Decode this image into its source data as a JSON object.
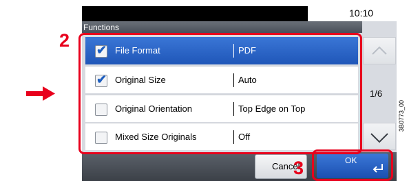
{
  "header": {
    "clock": "10:10",
    "section_title": "Functions"
  },
  "rows": [
    {
      "label": "File Format",
      "value": "PDF",
      "checked": true,
      "selected": true
    },
    {
      "label": "Original Size",
      "value": "Auto",
      "checked": true,
      "selected": false
    },
    {
      "label": "Original Orientation",
      "value": "Top Edge on Top",
      "checked": false,
      "selected": false
    },
    {
      "label": "Mixed Size Originals",
      "value": "Off",
      "checked": false,
      "selected": false
    }
  ],
  "pagination": {
    "indicator": "1/6"
  },
  "buttons": {
    "cancel": "Cancel",
    "ok": "OK"
  },
  "callouts": {
    "step_2": "2",
    "step_3": "3"
  },
  "side_code": "3B0773_00",
  "colors": {
    "accent_blue": "#1f56b8",
    "callout_red": "#e8001c"
  },
  "icons": {
    "check": "checkmark-icon",
    "up": "chevron-up-icon",
    "down": "chevron-down-icon",
    "enter": "enter-icon",
    "pointer": "right-arrow-icon"
  }
}
